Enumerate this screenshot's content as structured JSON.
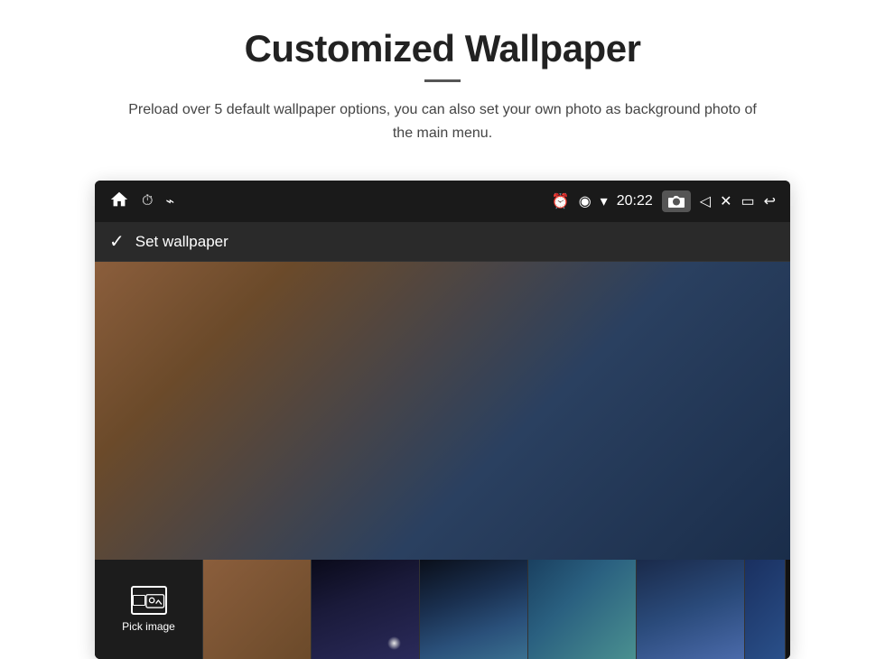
{
  "page": {
    "title": "Customized Wallpaper",
    "subtitle": "Preload over 5 default wallpaper options, you can also set your own photo as background photo of the main menu.",
    "divider": "—"
  },
  "device": {
    "statusBar": {
      "time": "20:22",
      "leftIcons": [
        "home",
        "clock",
        "usb"
      ],
      "rightIcons": [
        "alarm",
        "location",
        "wifi",
        "time",
        "camera",
        "volume",
        "close",
        "window",
        "back"
      ]
    },
    "wallpaperHeader": {
      "label": "Set wallpaper"
    },
    "thumbnails": [
      {
        "id": "pick-image",
        "label": "Pick image"
      },
      {
        "id": "thumb-brown",
        "label": ""
      },
      {
        "id": "thumb-space",
        "label": ""
      },
      {
        "id": "thumb-nebula",
        "label": ""
      },
      {
        "id": "thumb-ocean",
        "label": ""
      },
      {
        "id": "thumb-blue",
        "label": ""
      },
      {
        "id": "thumb-partial",
        "label": ""
      }
    ]
  }
}
